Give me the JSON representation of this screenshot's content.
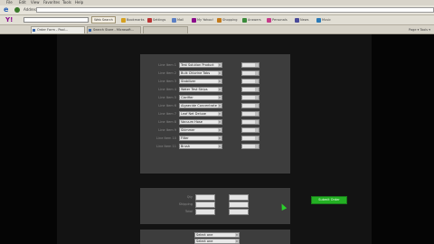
{
  "browser": {
    "menu": [
      "File",
      "Edit",
      "View",
      "Favorites",
      "Tools",
      "Help"
    ],
    "address_label": "Address",
    "address_value": "",
    "yahoo_logo": "Y!",
    "search_placeholder": "",
    "websearch_label": "Web Search",
    "toolbar_items": [
      "Bookmarks",
      "Settings",
      "Mail",
      "My Yahoo!",
      "Shopping",
      "Answers",
      "Personals",
      "News",
      "Music"
    ],
    "tabs": [
      {
        "label": "Order Form - Pool...",
        "active": true
      },
      {
        "label": "Search Store - Microsoft...",
        "active": false
      },
      {
        "label": "",
        "active": false
      }
    ],
    "tab_tools": "Page ▾  Tools ▾"
  },
  "form": {
    "row_labels": [
      "Line Item 1",
      "Line Item 2",
      "Line Item 3",
      "Line Item 4",
      "Line Item 5",
      "Line Item 6",
      "Line Item 7",
      "Line Item 8",
      "Line Item 9",
      "Line Item 10",
      "Line Item 11"
    ],
    "left_options": [
      "Test Solution Product",
      "Bulk Chlorine Tabs",
      "Stabilizer",
      "Water Test Strips",
      "Clarifier",
      "Algaecide Concentrate",
      "Leaf Net Deluxe",
      "Vacuum Hose",
      "Skimmer",
      "Filter",
      "Brush"
    ],
    "shipping_labels": [
      "Qty",
      "Shipping",
      "Total"
    ],
    "submit_label": "Submit Order",
    "bottom_options": [
      "Select one",
      "Select one",
      "Select one",
      "Select one",
      "Select one"
    ]
  },
  "colors": {
    "page_bg": "#050505",
    "panel_bg": "#3d3d3d",
    "submit_bg": "#23b023"
  }
}
